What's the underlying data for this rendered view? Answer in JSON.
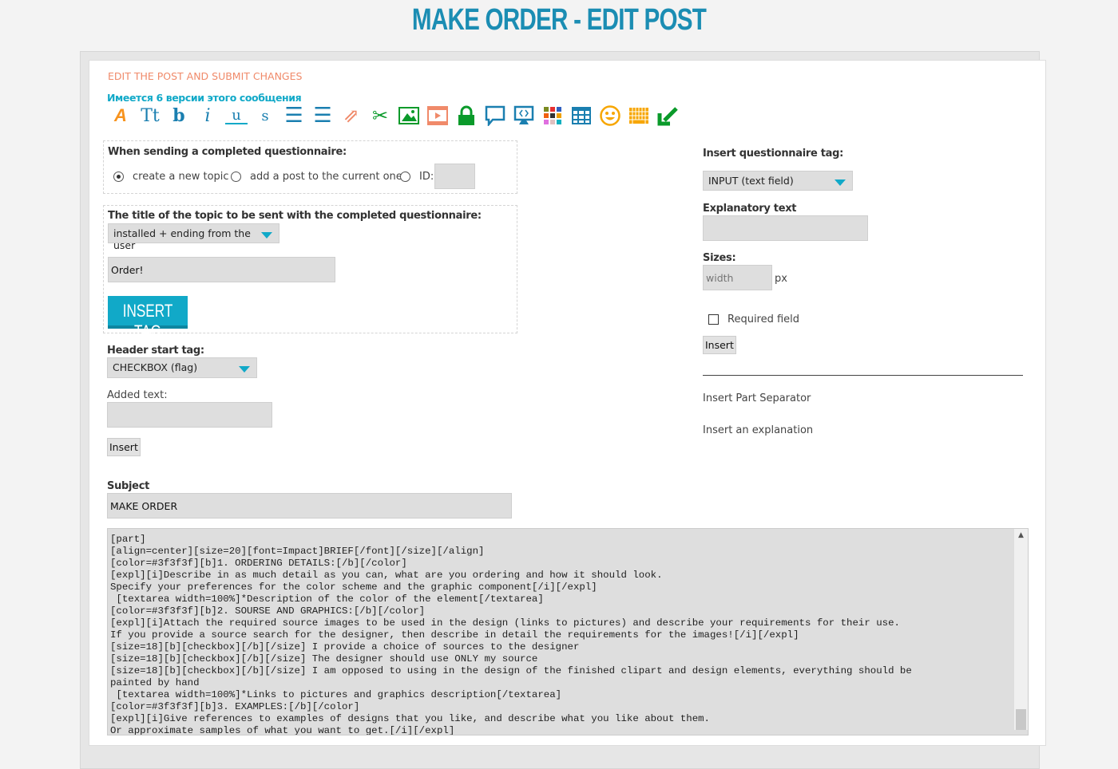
{
  "page_title": "MAKE ORDER - EDIT POST",
  "section_title": "EDIT THE POST AND SUBMIT CHANGES",
  "versions_link": "Имеется 6 версии этого сообщения",
  "toolbar": [
    "font-color-icon",
    "font-size-icon",
    "bold-icon",
    "italic-icon",
    "underline-icon",
    "strikethrough-icon",
    "align-center-icon",
    "align-left-icon",
    "link-icon",
    "cut-icon",
    "image-icon",
    "video-icon",
    "lock-icon",
    "quote-icon",
    "code-icon",
    "color-palette-icon",
    "table-icon",
    "smiley-icon",
    "keyboard-icon",
    "arrow-down-left-icon"
  ],
  "send": {
    "label": "When sending a completed questionnaire:",
    "options": [
      "create a new topic",
      "add a post to the current one",
      "ID:"
    ],
    "selected": 0,
    "id_value": ""
  },
  "topic": {
    "label": "The title of the topic to be sent with the completed questionnaire:",
    "select": "installed + ending from the user",
    "value": "Order!",
    "insert_tag": "INSERT TAG"
  },
  "header_tag": {
    "label": "Header start tag:",
    "select": "CHECKBOX (flag)"
  },
  "added_text": {
    "label": "Added text:",
    "value": "",
    "insert": "Insert"
  },
  "subject": {
    "label": "Subject",
    "value": "MAKE ORDER"
  },
  "right": {
    "tag_label": "Insert questionnaire tag:",
    "tag_select": "INPUT (text field)",
    "expl_label": "Explanatory text",
    "expl_value": "",
    "sizes_label": "Sizes:",
    "width_placeholder": "width",
    "px": "px",
    "required": "Required field",
    "required_checked": false,
    "insert": "Insert",
    "separator": "Insert Part Separator",
    "explanation": "Insert an explanation"
  },
  "colors": {
    "accent": "#1b8db3",
    "section": "#f08a6a",
    "link": "#11a9c8"
  },
  "editor_text": "[part]\n[align=center][size=20][font=Impact]BRIEF[/font][/size][/align]\n[color=#3f3f3f][b]1. ORDERING DETAILS:[/b][/color]\n[expl][i]Describe in as much detail as you can, what are you ordering and how it should look.\nSpecify your preferences for the color scheme and the graphic component[/i][/expl]\n [textarea width=100%]*Description of the color of the element[/textarea]\n[color=#3f3f3f][b]2. SOURSE AND GRAPHICS:[/b][/color]\n[expl][i]Attach the required source images to be used in the design (links to pictures) and describe your requirements for their use.\nIf you provide a source search for the designer, then describe in detail the requirements for the images![/i][/expl]\n[size=18][b][checkbox][/b][/size] I provide a choice of sources to the designer\n[size=18][b][checkbox][/b][/size] The designer should use ONLY my source\n[size=18][b][checkbox][/b][/size] I am opposed to using in the design of the finished clipart and design elements, everything should be\npainted by hand\n [textarea width=100%]*Links to pictures and graphics description[/textarea]\n[color=#3f3f3f][b]3. EXAMPLES:[/b][/color]\n[expl][i]Give references to examples of designs that you like, and describe what you like about them.\nOr approximate samples of what you want to get.[/i][/expl]"
}
